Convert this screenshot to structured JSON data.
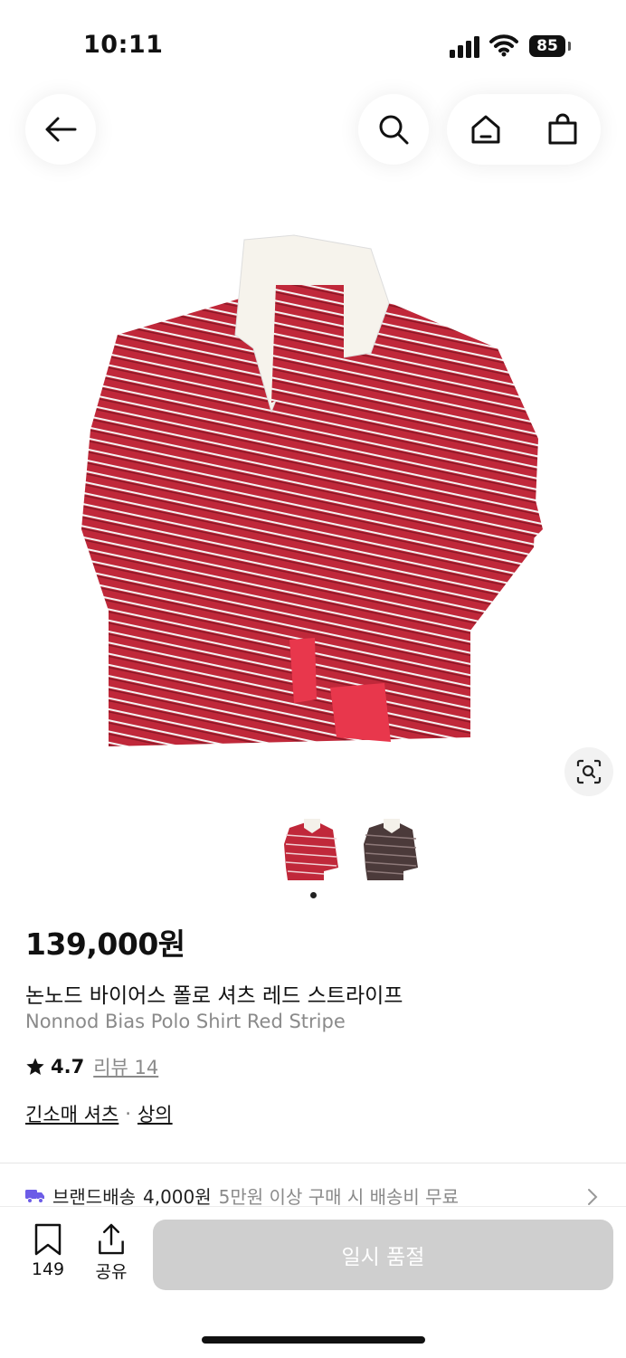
{
  "status_bar": {
    "time": "10:11",
    "battery": "85"
  },
  "product": {
    "price": "139,000원",
    "name_ko": "논노드 바이어스 폴로 셔츠 레드 스트라이프",
    "name_en": "Nonnod Bias Polo Shirt Red Stripe",
    "rating": "4.7",
    "review_label": "리뷰 14",
    "categories": [
      "긴소매 셔츠",
      "상의"
    ],
    "category_separator": "·",
    "image_count": 2,
    "active_image": 1
  },
  "shipping": {
    "label": "브랜드배송",
    "fee": "4,000원",
    "condition": "5만원 이상 구매 시 배송비 무료"
  },
  "bottom_bar": {
    "save_count": "149",
    "share_label": "공유",
    "soldout_label": "일시 품절"
  },
  "colors": {
    "accent_truck": "#6c5ce7",
    "shirt_red": "#c0283a",
    "soldout_bg": "#cfcfcf"
  }
}
